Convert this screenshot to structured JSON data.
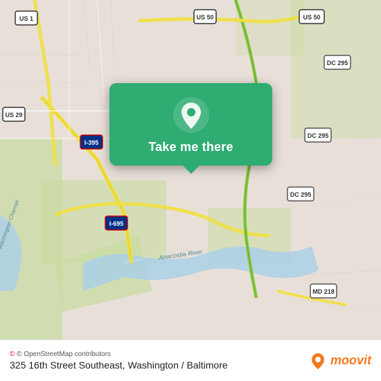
{
  "map": {
    "alt": "Map of Washington DC / Baltimore area"
  },
  "popup": {
    "take_me_there_label": "Take me there",
    "pin_icon": "location-pin-icon"
  },
  "footer": {
    "attribution": "© OpenStreetMap contributors",
    "address": "325 16th Street Southeast, Washington / Baltimore",
    "brand": "moovit"
  },
  "colors": {
    "popup_bg": "#2eac72",
    "moovit_orange": "#f47920",
    "road_yellow": "#f0e040",
    "road_green": "#b8d080",
    "water_blue": "#aad0e8",
    "bg_tan": "#e8e0d8"
  }
}
